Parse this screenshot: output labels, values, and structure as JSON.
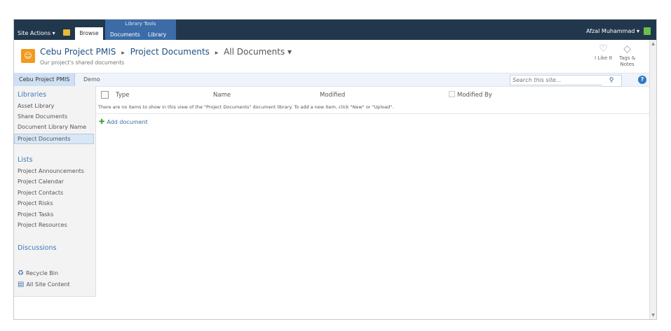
{
  "ribbon": {
    "site_actions": "Site Actions ▾",
    "browse_tab": "Browse",
    "library_tools": "Library Tools",
    "documents_tab": "Documents",
    "library_tab": "Library",
    "user": "Afzal Muhammad ▾"
  },
  "header": {
    "site_name": "Cebu Project PMIS",
    "sep": "▸",
    "library": "Project Documents",
    "view": "All Documents ▾",
    "description": "Our project's shared documents",
    "i_like_it": "I Like It",
    "tags_notes_1": "Tags &",
    "tags_notes_2": "Notes"
  },
  "topbar": {
    "home": "Cebu Project PMIS",
    "demo": "Demo",
    "search_placeholder": "Search this site..."
  },
  "leftnav": {
    "libraries_head": "Libraries",
    "libraries": [
      "Asset Library",
      "Share Documents",
      "Document Library Name",
      "Project Documents"
    ],
    "lists_head": "Lists",
    "lists": [
      "Project Announcements",
      "Project Calendar",
      "Project Contacts",
      "Project Risks",
      "Project Tasks",
      "Project Resources"
    ],
    "discussions_head": "Discussions",
    "recycle_bin": "Recycle Bin",
    "all_site_content": "All Site Content"
  },
  "main": {
    "col_type": "Type",
    "col_name": "Name",
    "col_modified": "Modified",
    "col_modified_by": "Modified By",
    "empty_message": "There are no items to show in this view of the \"Project Documents\" document library. To add a new item, click \"New\" or \"Upload\".",
    "add_document": "Add document"
  }
}
